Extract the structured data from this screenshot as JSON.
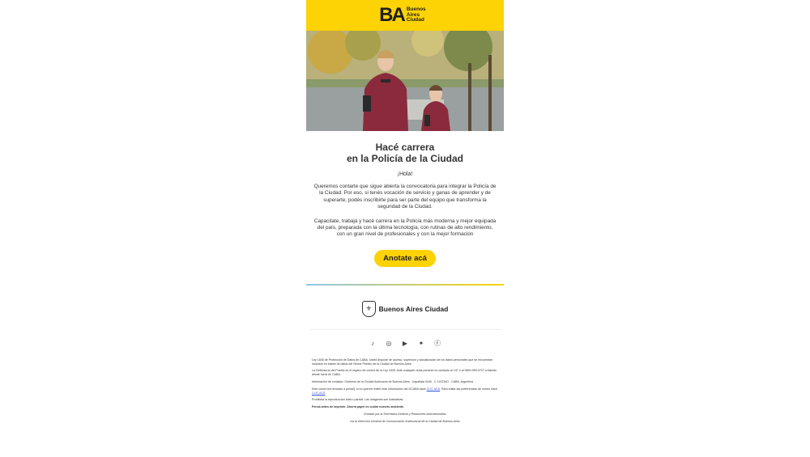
{
  "brand": {
    "logo_mark": "BA",
    "logo_text": "Buenos Aires Ciudad",
    "yellow": "#fdd306"
  },
  "title": {
    "line1": "Hacé carrera",
    "line2": "en la Policía de la Ciudad"
  },
  "greeting": "¡Hola!",
  "paragraph1": "Queremos contarte que sigue abierta la convocatoria para integrar la Policía de la Ciudad. Por eso, si tenés vocación de servicio y ganas de aprender y de superarte, podés inscribirte para ser parte del equipo que transforma la seguridad de la Ciudad.",
  "paragraph2": "Capacitate, trabajá y hacé carrera en la Policía más moderna y mejor equipada del país, preparada con la última tecnología, con rutinas de alto rendimiento, con un gran nivel de profesionales y con la mejor formación",
  "cta": {
    "label": "Anotate acá"
  },
  "footer": {
    "logo_text": "Buenos Aires Ciudad",
    "social_icons": [
      "tiktok-icon",
      "instagram-icon",
      "youtube-icon",
      "twitter-icon",
      "facebook-icon"
    ]
  },
  "legal": {
    "p1": "Ley 1845 de Protección de Datos de CABA. Usted dispone de acceso, supresión y actualización de los datos personales que se encuentran incluidos en bases de datos del Sector Público de la Ciudad de Buenos Aires.",
    "p2": "La Defensoría del Pueblo es el órgano de control de la Ley 1845. Ante cualquier duda ponerse en contacto al 147 o al 0800-999-3727 si llamás desde fuera de CABA.",
    "p3": "Información de contacto: Gobierno de la Ciudad Autónoma de Buenos Aires - Uspallata 3160 - C 1437AIO - CABA, Argentina",
    "p4_text": "Este correo fue enviado a {email}, si no querés recibir más información del GCABA hacé",
    "p4_link1": "CLIC ACÁ",
    "p4_mid": ". Para editar las preferencias de correo hacé",
    "p4_link2": "CLIC ACÁ",
    "p5": "Prohibida la reproducción total o parcial. Las imágenes son ilustrativas.",
    "p6": "Pensá antes de imprimir. Ahorrá papel es cuidar nuestro ambiente.",
    "p7a": "Enviado por la Secretaría General y Relaciones Internacionales",
    "p7b": "vía la Dirección General de Comunicación Institucional de la Ciudad de Buenos Aires"
  }
}
